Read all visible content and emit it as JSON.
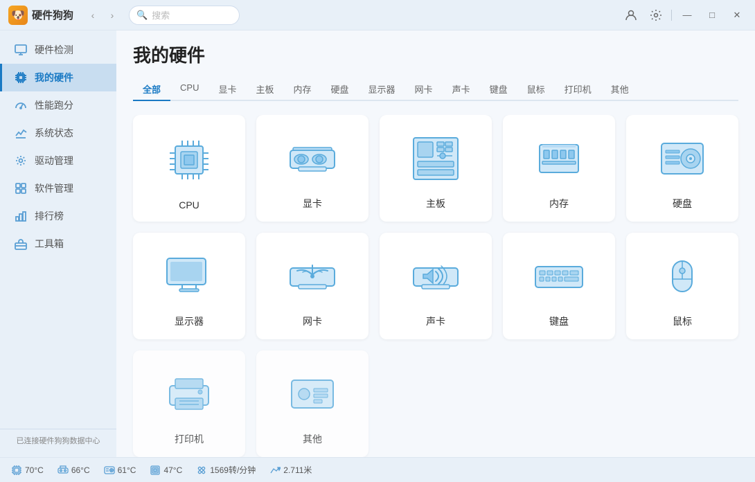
{
  "app": {
    "title": "硬件狗狗",
    "logo": "🐶"
  },
  "titlebar": {
    "search_placeholder": "搜索",
    "nav_back": "‹",
    "nav_forward": "›",
    "minimize": "—",
    "maximize": "□",
    "close": "✕"
  },
  "sidebar": {
    "items": [
      {
        "id": "hardware-detection",
        "label": "硬件检测",
        "icon": "monitor"
      },
      {
        "id": "my-hardware",
        "label": "我的硬件",
        "icon": "chip",
        "active": true
      },
      {
        "id": "performance",
        "label": "性能跑分",
        "icon": "speedometer"
      },
      {
        "id": "system-status",
        "label": "系统状态",
        "icon": "chart"
      },
      {
        "id": "driver-mgmt",
        "label": "驱动管理",
        "icon": "gear"
      },
      {
        "id": "software-mgmt",
        "label": "软件管理",
        "icon": "apps"
      },
      {
        "id": "ranking",
        "label": "排行榜",
        "icon": "ranking"
      },
      {
        "id": "toolbox",
        "label": "工具箱",
        "icon": "toolbox"
      }
    ],
    "footer": "已连接硬件狗狗数据中心"
  },
  "content": {
    "page_title": "我的硬件",
    "tabs": [
      {
        "id": "all",
        "label": "全部",
        "active": true
      },
      {
        "id": "cpu",
        "label": "CPU"
      },
      {
        "id": "gpu",
        "label": "显卡"
      },
      {
        "id": "motherboard",
        "label": "主板"
      },
      {
        "id": "memory",
        "label": "内存"
      },
      {
        "id": "storage",
        "label": "硬盘"
      },
      {
        "id": "monitor",
        "label": "显示器"
      },
      {
        "id": "network",
        "label": "网卡"
      },
      {
        "id": "sound",
        "label": "声卡"
      },
      {
        "id": "keyboard",
        "label": "键盘"
      },
      {
        "id": "mouse",
        "label": "鼠标"
      },
      {
        "id": "printer",
        "label": "打印机"
      },
      {
        "id": "other",
        "label": "其他"
      }
    ],
    "hardware_items": [
      {
        "id": "cpu",
        "label": "CPU",
        "row": 1
      },
      {
        "id": "gpu",
        "label": "显卡",
        "row": 1
      },
      {
        "id": "motherboard",
        "label": "主板",
        "row": 1
      },
      {
        "id": "memory",
        "label": "内存",
        "row": 1
      },
      {
        "id": "storage",
        "label": "硬盘",
        "row": 1
      },
      {
        "id": "monitor",
        "label": "显示器",
        "row": 2
      },
      {
        "id": "network",
        "label": "网卡",
        "row": 2
      },
      {
        "id": "sound",
        "label": "声卡",
        "row": 2
      },
      {
        "id": "keyboard",
        "label": "键盘",
        "row": 2
      },
      {
        "id": "mouse",
        "label": "鼠标",
        "row": 2
      }
    ]
  },
  "statusbar": {
    "items": [
      {
        "id": "cpu-temp",
        "icon": "cpu",
        "value": "70°C"
      },
      {
        "id": "gpu-temp",
        "icon": "gpu",
        "value": "66°C"
      },
      {
        "id": "hdd-temp",
        "icon": "hdd",
        "value": "61°C"
      },
      {
        "id": "cpu-usage",
        "icon": "chip2",
        "value": "47°C"
      },
      {
        "id": "fan-speed",
        "icon": "fan",
        "value": "1569转/分钟"
      },
      {
        "id": "network-speed",
        "icon": "network",
        "value": "2.711米"
      }
    ]
  }
}
